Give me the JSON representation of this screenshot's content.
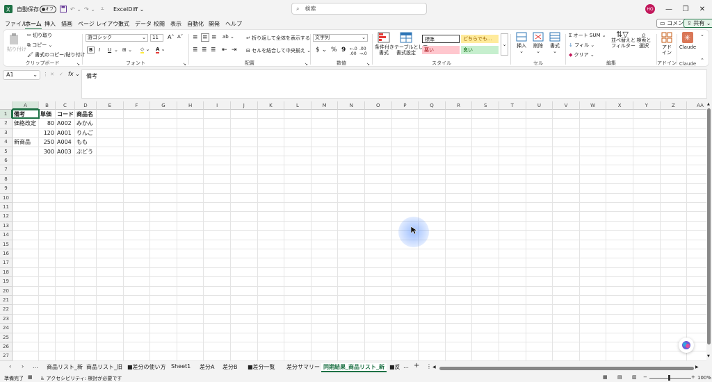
{
  "titlebar": {
    "autosave_label": "自動保存",
    "autosave_state": "オフ",
    "file_name": "ExcelDiff",
    "search_placeholder": "検索",
    "avatar_initials": "HO"
  },
  "menu": {
    "items": [
      "ファイル",
      "ホーム",
      "挿入",
      "描画",
      "ページ レイアウト",
      "数式",
      "データ",
      "校閲",
      "表示",
      "自動化",
      "開発",
      "ヘルプ"
    ],
    "active": "ホーム",
    "comment_label": "コメント",
    "share_label": "共有"
  },
  "ribbon": {
    "clipboard": {
      "paste": "貼り付け",
      "cut": "切り取り",
      "copy": "コピー",
      "format_painter": "書式のコピー/貼り付け",
      "label": "クリップボード"
    },
    "font": {
      "name": "游ゴシック",
      "size": "11",
      "bold": "B",
      "italic": "I",
      "underline": "U",
      "label": "フォント"
    },
    "alignment": {
      "wrap": "折り返して全体を表示する",
      "merge": "セルを結合して中央揃え",
      "label": "配置"
    },
    "number": {
      "format": "文字列",
      "currency": "$",
      "percent": "%",
      "comma": "9",
      "label": "数値"
    },
    "styles": {
      "conditional": "条件付き\n書式",
      "table": "テーブルとして\n書式設定",
      "normal": "標準",
      "neutral": "どちらでも...",
      "bad": "悪い",
      "good": "良い",
      "label": "スタイル"
    },
    "cells": {
      "insert": "挿入",
      "delete": "削除",
      "format": "書式",
      "label": "セル"
    },
    "editing": {
      "autosum": "オート SUM",
      "fill": "フィル",
      "clear": "クリア",
      "sort": "並べ替えと\nフィルター",
      "find": "検索と\n選択",
      "label": "編集"
    },
    "addins": {
      "addin": "アド\nイン",
      "label": "アドイン"
    },
    "claude": {
      "button": "Claude",
      "label": "Claude"
    }
  },
  "formula": {
    "name_box": "A1",
    "fx": "fx",
    "content": "備考"
  },
  "columns": [
    "A",
    "B",
    "C",
    "D",
    "E",
    "F",
    "G",
    "H",
    "I",
    "J",
    "K",
    "L",
    "M",
    "N",
    "O",
    "P",
    "Q",
    "R",
    "S",
    "T",
    "U",
    "V",
    "W",
    "X",
    "Y",
    "Z",
    "AA"
  ],
  "rows": [
    "1",
    "2",
    "3",
    "4",
    "5",
    "6",
    "7",
    "8",
    "9",
    "10",
    "11",
    "12",
    "13",
    "14",
    "15",
    "16",
    "17",
    "18",
    "19",
    "20",
    "21",
    "22",
    "23",
    "24",
    "25",
    "26",
    "27"
  ],
  "cells": [
    {
      "r": 1,
      "c": 0,
      "v": "備考",
      "type": "hdr"
    },
    {
      "r": 1,
      "c": 1,
      "v": "単価",
      "type": "hdr"
    },
    {
      "r": 1,
      "c": 2,
      "v": "コード",
      "type": "hdr"
    },
    {
      "r": 1,
      "c": 3,
      "v": "商品名",
      "type": "hdr"
    },
    {
      "r": 2,
      "c": 0,
      "v": "価格改定",
      "type": "text"
    },
    {
      "r": 2,
      "c": 1,
      "v": "80",
      "type": "num"
    },
    {
      "r": 2,
      "c": 2,
      "v": "A002",
      "type": "text"
    },
    {
      "r": 2,
      "c": 3,
      "v": "みかん",
      "type": "text"
    },
    {
      "r": 3,
      "c": 1,
      "v": "120",
      "type": "num"
    },
    {
      "r": 3,
      "c": 2,
      "v": "A001",
      "type": "text"
    },
    {
      "r": 3,
      "c": 3,
      "v": "りんご",
      "type": "text"
    },
    {
      "r": 4,
      "c": 0,
      "v": "新商品",
      "type": "text"
    },
    {
      "r": 4,
      "c": 1,
      "v": "250",
      "type": "num"
    },
    {
      "r": 4,
      "c": 2,
      "v": "A004",
      "type": "text"
    },
    {
      "r": 4,
      "c": 3,
      "v": "もも",
      "type": "text"
    },
    {
      "r": 5,
      "c": 1,
      "v": "300",
      "type": "num"
    },
    {
      "r": 5,
      "c": 2,
      "v": "A003",
      "type": "text"
    },
    {
      "r": 5,
      "c": 3,
      "v": "ぶどう",
      "type": "text"
    }
  ],
  "sheets": {
    "tabs": [
      "商品リスト_新",
      "商品リスト_旧",
      "■差分の使い方",
      "Sheet1",
      "差分A",
      "差分B",
      "■差分一覧",
      "差分サマリー",
      "同期結果_商品リスト_新",
      "■反"
    ],
    "active_index": 8,
    "ellipsis": "..."
  },
  "status": {
    "ready": "準備完了",
    "accessibility": "アクセシビリティ: 検討が必要です",
    "zoom": "100%"
  },
  "colors": {
    "accent": "#1e7145",
    "selection": "#1e7145"
  }
}
